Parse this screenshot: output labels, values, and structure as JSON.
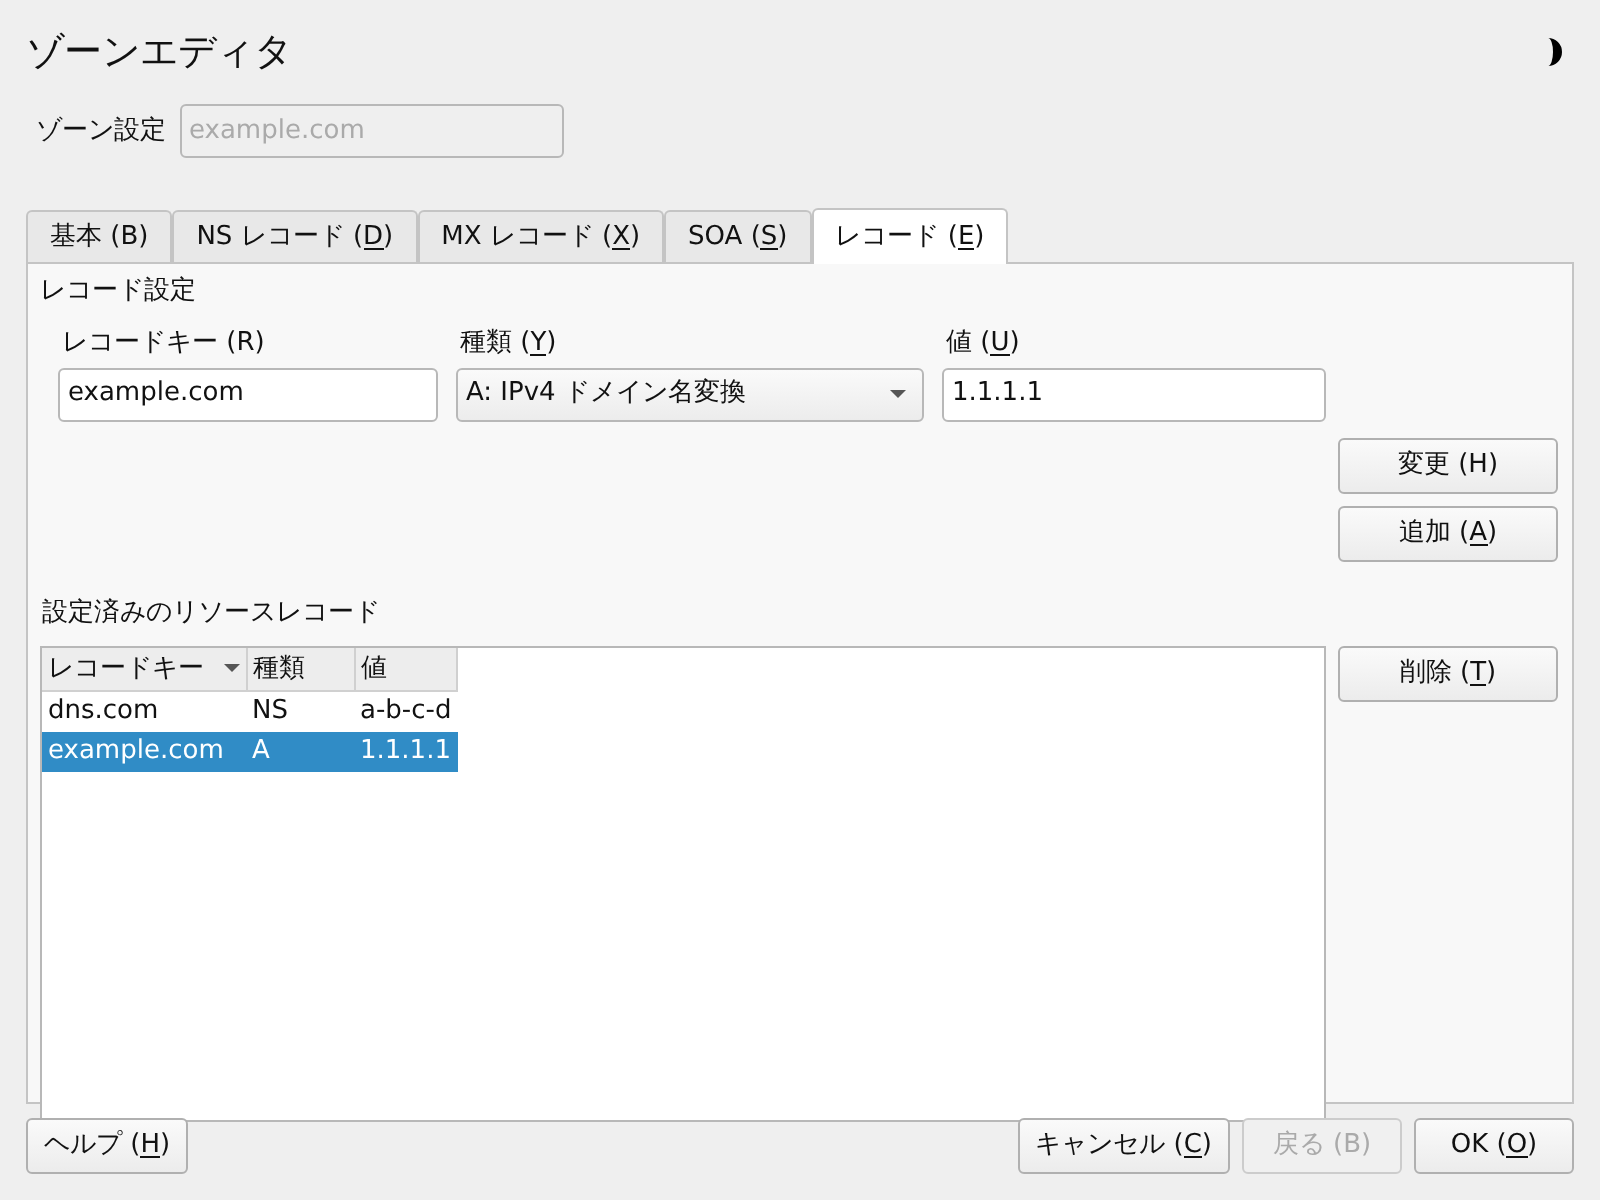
{
  "window": {
    "title": "ゾーンエディタ"
  },
  "zone": {
    "label": "ゾーン設定",
    "placeholder": "example.com",
    "disabled": true
  },
  "tabs": [
    {
      "label": "基本 (B)",
      "underline_mnemonic": false,
      "selected": false
    },
    {
      "label": "NS レコード (D)",
      "underline_mnemonic": true,
      "selected": false
    },
    {
      "label": "MX レコード (X)",
      "underline_mnemonic": true,
      "selected": false
    },
    {
      "label": "SOA (S)",
      "underline_mnemonic": true,
      "selected": false
    },
    {
      "label": "レコード (E)",
      "underline_mnemonic": true,
      "selected": true
    }
  ],
  "record_settings": {
    "title": "レコード設定",
    "fields": [
      {
        "kind": "text",
        "label": "レコードキー (R)",
        "underline_mnemonic": false,
        "value": "example.com"
      },
      {
        "kind": "select",
        "label": "種類 (Y)",
        "underline_mnemonic": true,
        "value": "A: IPv4 ドメイン名変換"
      },
      {
        "kind": "text",
        "label": "値 (U)",
        "underline_mnemonic": true,
        "value": "1.1.1.1"
      }
    ],
    "buttons": [
      {
        "label": "変更 (H)",
        "underline_mnemonic": false
      },
      {
        "label": "追加 (A)",
        "underline_mnemonic": true
      }
    ]
  },
  "records": {
    "title": "設定済みのリソースレコード",
    "columns": [
      {
        "label": "レコードキー",
        "sorted": true
      },
      {
        "label": "種類",
        "sorted": false
      },
      {
        "label": "値",
        "sorted": false
      }
    ],
    "rows": [
      {
        "cells": [
          "dns.com",
          "NS",
          "a-b-c-d"
        ],
        "selected": false
      },
      {
        "cells": [
          "example.com",
          "A",
          "1.1.1.1"
        ],
        "selected": true
      }
    ],
    "buttons": [
      {
        "label": "削除 (T)",
        "underline_mnemonic": true
      }
    ]
  },
  "footer": {
    "left_buttons": [
      {
        "label": "ヘルプ (H)",
        "underline_mnemonic": true,
        "disabled": false
      }
    ],
    "right_buttons": [
      {
        "label": "キャンセル (C)",
        "underline_mnemonic": true,
        "disabled": false
      },
      {
        "label": "戻る (B)",
        "underline_mnemonic": false,
        "disabled": true
      },
      {
        "label": "OK (O)",
        "underline_mnemonic": true,
        "disabled": false
      }
    ]
  }
}
